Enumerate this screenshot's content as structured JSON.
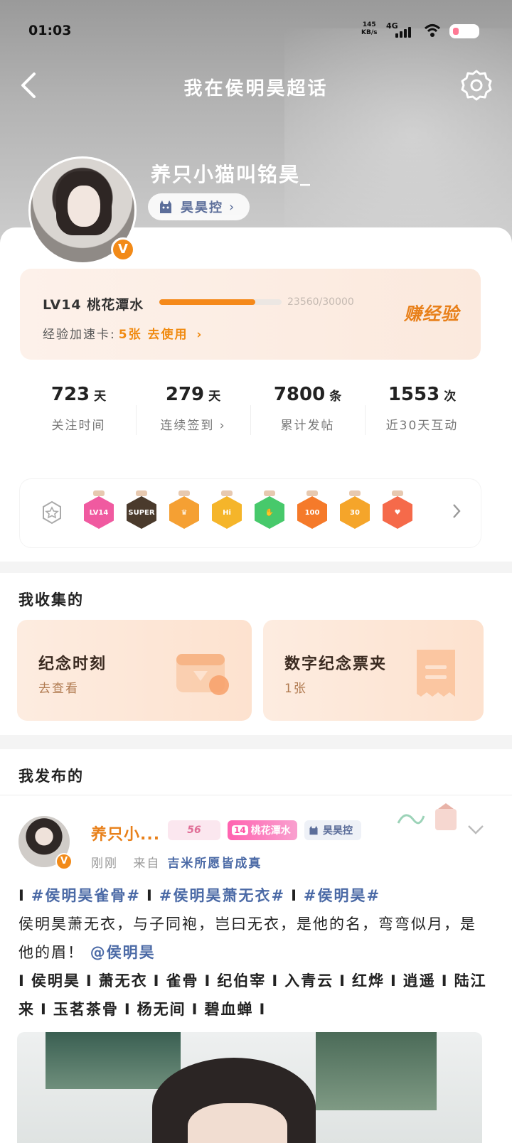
{
  "status_bar": {
    "time": "01:03",
    "speed_value": "145",
    "speed_unit": "KB/s",
    "network": "4G"
  },
  "nav": {
    "title": "我在侯明昊超话"
  },
  "profile": {
    "username": "养只小猫叫铭昊_",
    "fan_title": "昊昊控",
    "verified_mark": "V"
  },
  "level": {
    "label": "LV14 桃花潭水",
    "exp_text": "23560/30000",
    "progress": 0.785,
    "accel_label": "经验加速卡:",
    "accel_value": "5张 去使用",
    "earn_label": "赚经验"
  },
  "stats": [
    {
      "value": "723",
      "unit": "天",
      "label": "关注时间"
    },
    {
      "value": "279",
      "unit": "天",
      "label": "连续签到 ›"
    },
    {
      "value": "7800",
      "unit": "条",
      "label": "累计发帖"
    },
    {
      "value": "1553",
      "unit": "次",
      "label": "近30天互动"
    }
  ],
  "badges": [
    {
      "text": "LV14",
      "color": "#f05aa0",
      "icon": "lv14-badge-icon"
    },
    {
      "text": "SUPER",
      "color": "#4a3a2c",
      "icon": "super-badge-icon"
    },
    {
      "text": "♛",
      "color": "#f5a033",
      "icon": "crown-badge-icon"
    },
    {
      "text": "Hi",
      "color": "#f5b52a",
      "icon": "hi-badge-icon"
    },
    {
      "text": "✋",
      "color": "#47c96b",
      "icon": "hand-badge-icon"
    },
    {
      "text": "100",
      "color": "#f57a2a",
      "icon": "100-days-badge-icon"
    },
    {
      "text": "30",
      "color": "#f5a52a",
      "icon": "30-days-badge-icon"
    },
    {
      "text": "♥",
      "color": "#f56a4a",
      "icon": "heart-hand-badge-icon"
    }
  ],
  "collect": {
    "title": "我收集的",
    "items": [
      {
        "title": "纪念时刻",
        "sub": "去查看"
      },
      {
        "title": "数字纪念票夹",
        "sub": "1张"
      }
    ]
  },
  "posts": {
    "title": "我发布的",
    "author": "养只小...",
    "tag_cat": "56",
    "tag_level_num": "14",
    "tag_level_name": "桃花潭水",
    "tag_fan": "昊昊控",
    "time": "刚刚",
    "source_prefix": "来自",
    "source": "吉米所愿皆成真",
    "hashtags": [
      "#侯明昊雀骨#",
      "#侯明昊萧无衣#",
      "#侯明昊#"
    ],
    "text": "侯明昊萧无衣，与子同袍，岂曰无衣，是他的名，弯弯似月，是他的眉！",
    "mention": "@侯明昊",
    "roles": [
      "侯明昊",
      "萧无衣",
      "雀骨",
      "纪伯宰",
      "入青云",
      "红烨",
      "逍遥",
      "陆江来",
      "玉茗茶骨",
      "杨无间",
      "碧血蝉"
    ]
  },
  "colors": {
    "accent_orange": "#f08a10",
    "link_blue": "#4b6aa6"
  }
}
